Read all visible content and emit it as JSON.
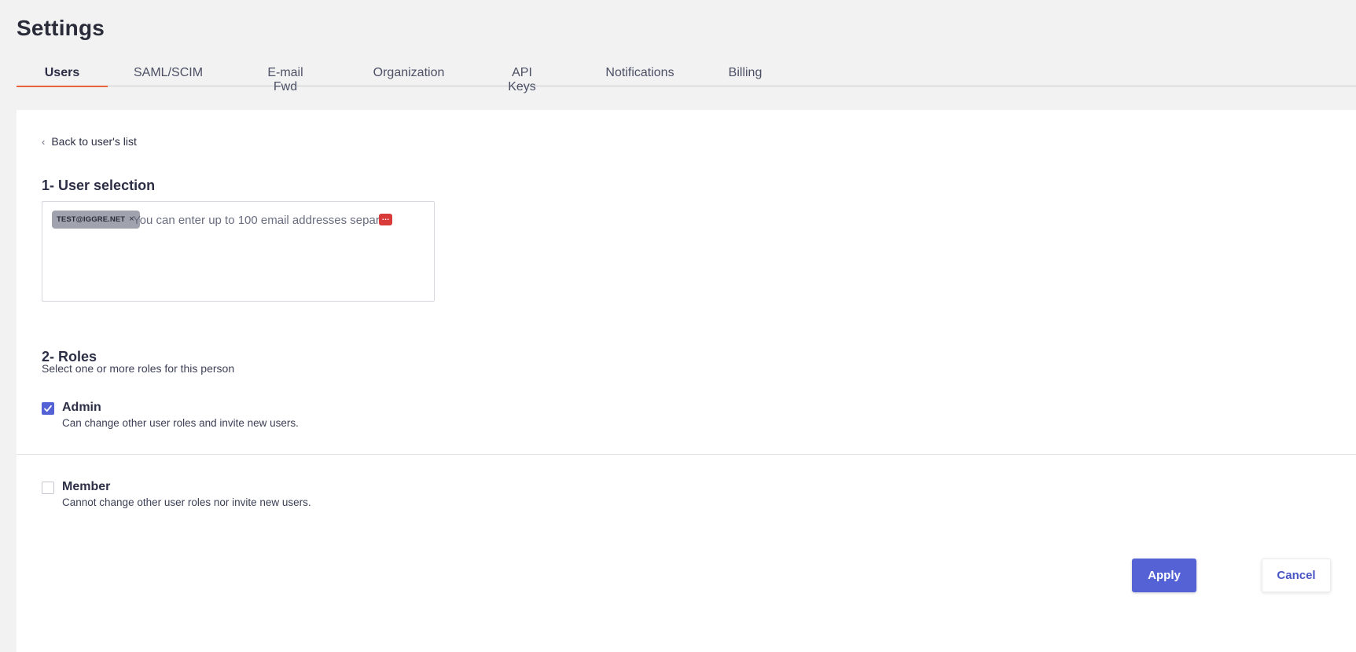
{
  "page": {
    "title": "Settings"
  },
  "tabs": [
    {
      "label": "Users",
      "active": true
    },
    {
      "label": "SAML/SCIM",
      "active": false
    },
    {
      "label": "E-mail Fwd",
      "active": false
    },
    {
      "label": "Organization",
      "active": false
    },
    {
      "label": "API Keys",
      "active": false
    },
    {
      "label": "Notifications",
      "active": false
    },
    {
      "label": "Billing",
      "active": false
    }
  ],
  "back_link": {
    "icon": "chevron-left-icon",
    "label": "Back to user's list"
  },
  "user_selection": {
    "title": "1- User selection",
    "chips": [
      {
        "label": "TEST@IGGRE.NET",
        "remove_label": "×"
      }
    ],
    "input_placeholder": "You can enter up to 100 email addresses separ",
    "overflow_badge": "…"
  },
  "roles": {
    "title": "2- Roles",
    "subtitle": "Select one or more roles for this person",
    "items": [
      {
        "name": "Admin",
        "description": "Can change other user roles and invite new users.",
        "checked": true
      },
      {
        "name": "Member",
        "description": "Cannot change other user roles nor invite new users.",
        "checked": false
      }
    ]
  },
  "actions": {
    "apply_label": "Apply",
    "cancel_label": "Cancel"
  },
  "colors": {
    "accent": "#5462d6",
    "active_tab_underline": "#e8633a",
    "badge": "#d93a3a"
  }
}
